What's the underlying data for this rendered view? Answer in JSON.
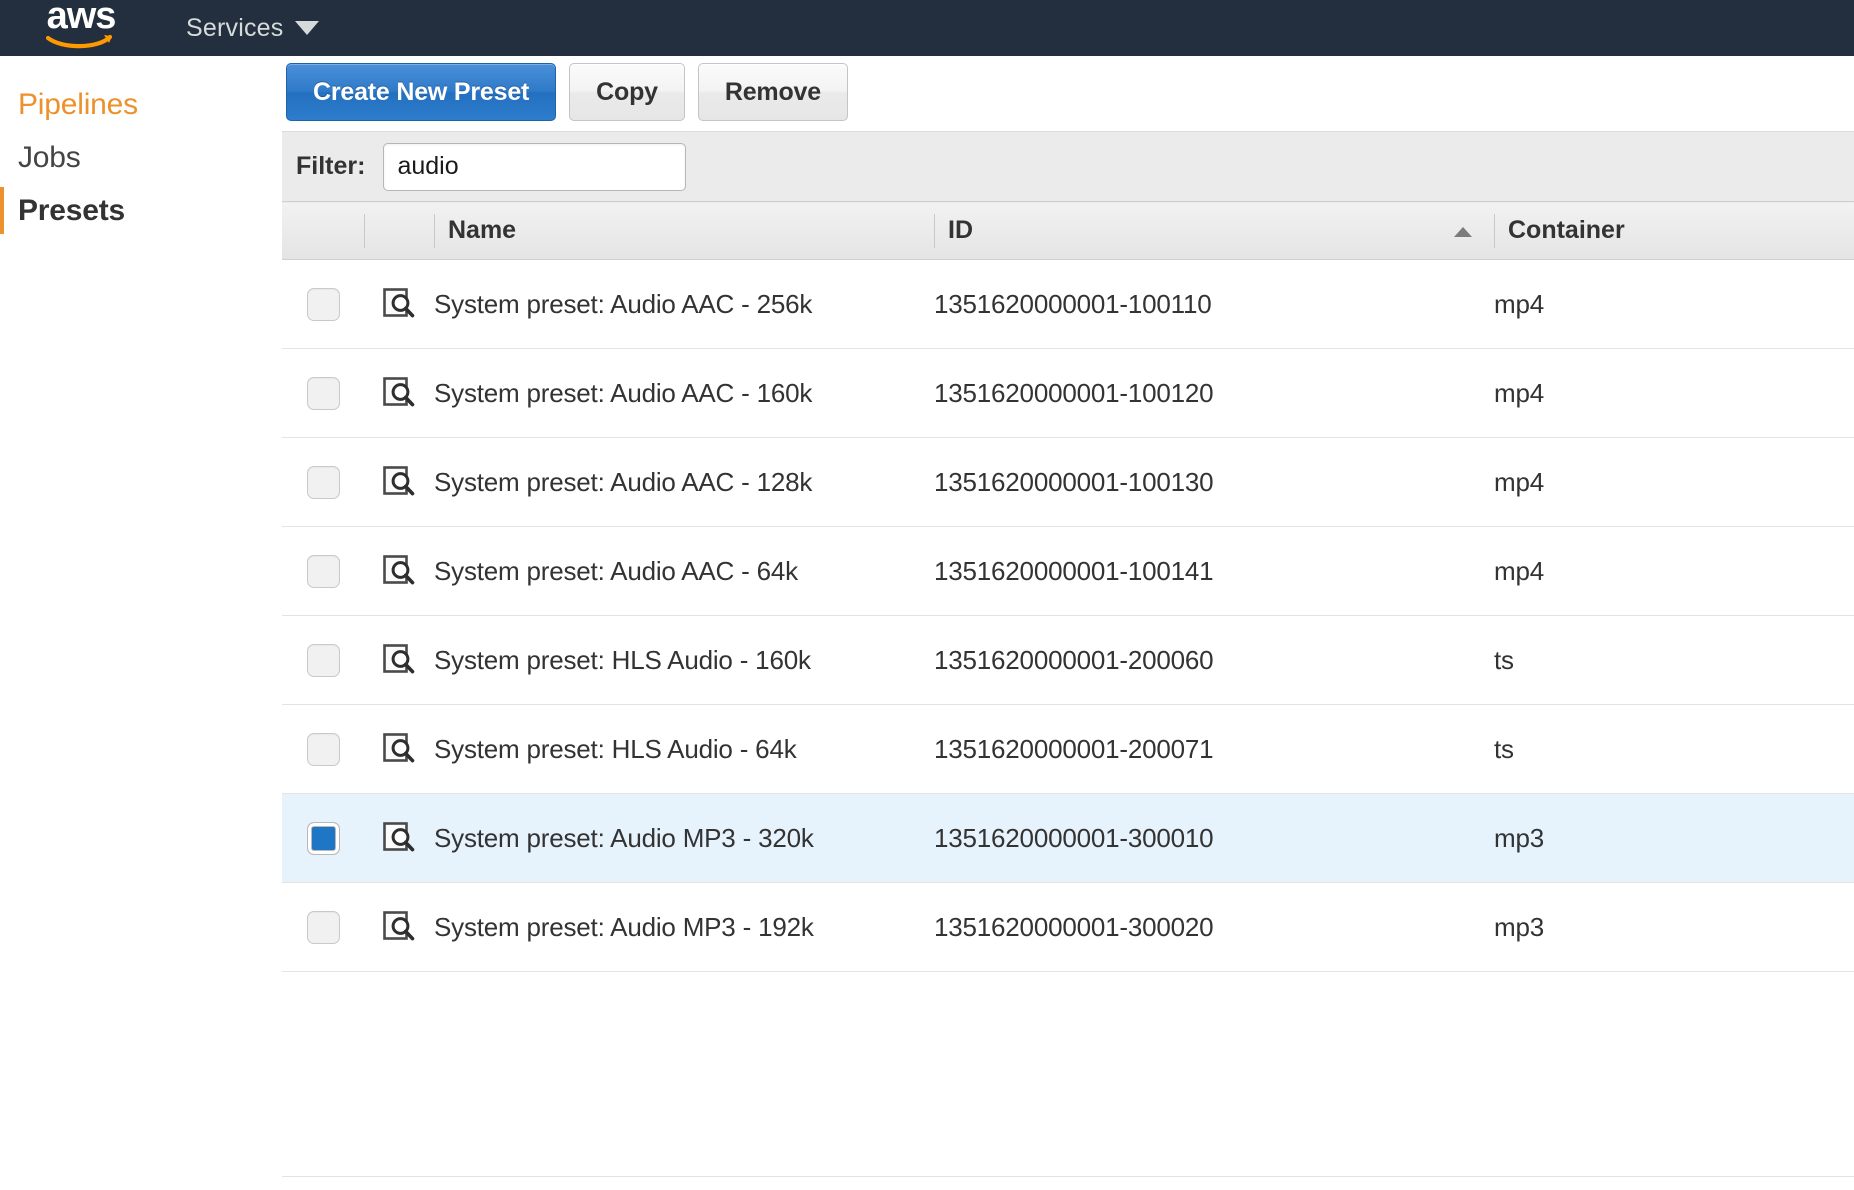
{
  "navbar": {
    "logo_text": "aws",
    "logo_icon": "aws-smile-logo",
    "services_label": "Services",
    "services_caret_icon": "chevron-down-icon"
  },
  "sidebar": {
    "items": [
      {
        "label": "Pipelines",
        "state": "link"
      },
      {
        "label": "Jobs",
        "state": "link"
      },
      {
        "label": "Presets",
        "state": "current"
      }
    ]
  },
  "toolbar": {
    "create_label": "Create New Preset",
    "copy_label": "Copy",
    "remove_label": "Remove"
  },
  "filter": {
    "label": "Filter:",
    "value": "audio",
    "placeholder": ""
  },
  "table": {
    "columns": {
      "select": "",
      "view": "",
      "name": "Name",
      "id": "ID",
      "container": "Container"
    },
    "sort": {
      "column": "ID",
      "direction": "ascending",
      "icon": "sort-ascending-icon"
    },
    "row_icon": "view-details-icon",
    "rows": [
      {
        "selected": false,
        "name": "System preset: Audio AAC - 256k",
        "id": "1351620000001-100110",
        "container": "mp4"
      },
      {
        "selected": false,
        "name": "System preset: Audio AAC - 160k",
        "id": "1351620000001-100120",
        "container": "mp4"
      },
      {
        "selected": false,
        "name": "System preset: Audio AAC - 128k",
        "id": "1351620000001-100130",
        "container": "mp4"
      },
      {
        "selected": false,
        "name": "System preset: Audio AAC - 64k",
        "id": "1351620000001-100141",
        "container": "mp4"
      },
      {
        "selected": false,
        "name": "System preset: HLS Audio - 160k",
        "id": "1351620000001-200060",
        "container": "ts"
      },
      {
        "selected": false,
        "name": "System preset: HLS Audio - 64k",
        "id": "1351620000001-200071",
        "container": "ts"
      },
      {
        "selected": true,
        "name": "System preset: Audio MP3 - 320k",
        "id": "1351620000001-300010",
        "container": "mp3"
      },
      {
        "selected": false,
        "name": "System preset: Audio MP3 - 192k",
        "id": "1351620000001-300020",
        "container": "mp3"
      }
    ]
  },
  "colors": {
    "navbar_bg": "#232f3e",
    "accent_orange": "#ec912d",
    "primary_button": "#2470c0",
    "selected_row": "#e6f2fc",
    "checkbox_checked": "#1f76c4"
  }
}
